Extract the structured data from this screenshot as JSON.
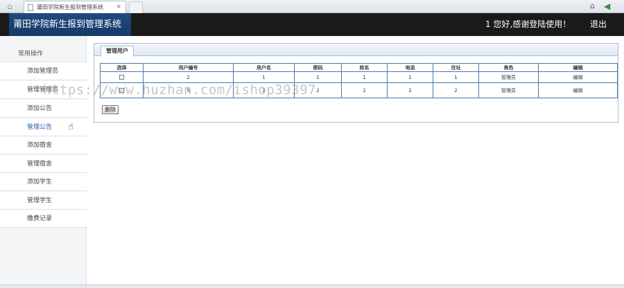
{
  "browser": {
    "tab_title": "莆田学院新生报到管理系统",
    "tab_close": "×",
    "home_icon": "home-icon",
    "page_icon": "page-icon"
  },
  "header": {
    "system_title": "莆田学院新生报到管理系统",
    "welcome": "1 您好,感谢登陆使用！",
    "logout": "退出"
  },
  "sidebar": {
    "heading": "常用操作",
    "items": [
      {
        "label": "添加管理员"
      },
      {
        "label": "管理管理员"
      },
      {
        "label": "添加公告"
      },
      {
        "label": "管理公告"
      },
      {
        "label": "添加宿舍"
      },
      {
        "label": "管理宿舍"
      },
      {
        "label": "添加学生"
      },
      {
        "label": "管理学生"
      },
      {
        "label": "缴费记录"
      }
    ]
  },
  "panel": {
    "tab_label": "管理用户",
    "columns": [
      "选择",
      "用户编号",
      "用户名",
      "密码",
      "姓名",
      "电话",
      "住址",
      "角色",
      "编辑"
    ],
    "rows": [
      {
        "id": "2",
        "username": "1",
        "password": "1",
        "name": "1",
        "phone": "1",
        "address": "1",
        "role": "管理员",
        "edit": "编辑"
      },
      {
        "id": "5",
        "username": "2",
        "password": "2",
        "name": "2",
        "phone": "2",
        "address": "2",
        "role": "管理员",
        "edit": "编辑"
      }
    ],
    "delete_label": "删除"
  },
  "watermark": "https://www.huzhan.com/ishop39397",
  "colors": {
    "header_bg": "#1a1a1a",
    "title_bg": "#1e4b80",
    "table_border": "#4a77b0",
    "active_link": "#2a5da0"
  }
}
